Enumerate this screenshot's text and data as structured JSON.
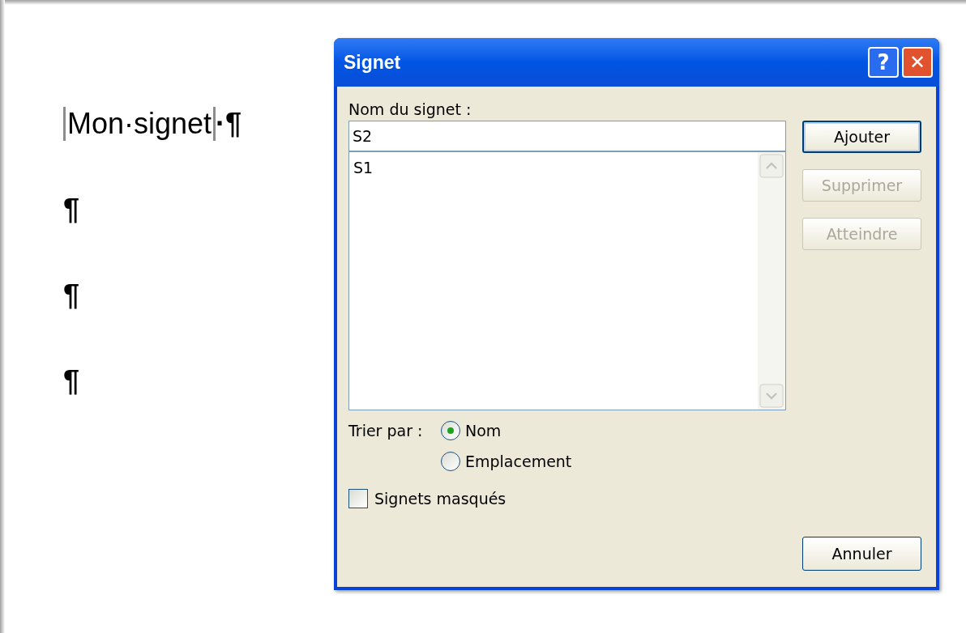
{
  "document": {
    "paragraphs": [
      {
        "text": "Mon·signet",
        "bookmarked": true,
        "mark": "·¶"
      },
      {
        "mark": "¶"
      },
      {
        "mark": "¶"
      },
      {
        "mark": "¶"
      }
    ]
  },
  "dialog": {
    "title": "Signet",
    "help_button": "?",
    "close_button": "✕",
    "name_label": "Nom du signet :",
    "name_value": "S2",
    "bookmarks": [
      {
        "name": "S1",
        "selected": false
      }
    ],
    "buttons": [
      {
        "label": "Ajouter",
        "disabled": false,
        "default": true
      },
      {
        "label": "Supprimer",
        "disabled": true,
        "default": false
      },
      {
        "label": "Atteindre",
        "disabled": true,
        "default": false
      }
    ],
    "sort_label": "Trier par :",
    "sort_options": [
      {
        "label": "Nom",
        "selected": true
      },
      {
        "label": "Emplacement",
        "selected": false
      }
    ],
    "hidden_checkbox": {
      "label": "Signets masqués",
      "checked": false
    },
    "cancel_button": "Annuler"
  }
}
